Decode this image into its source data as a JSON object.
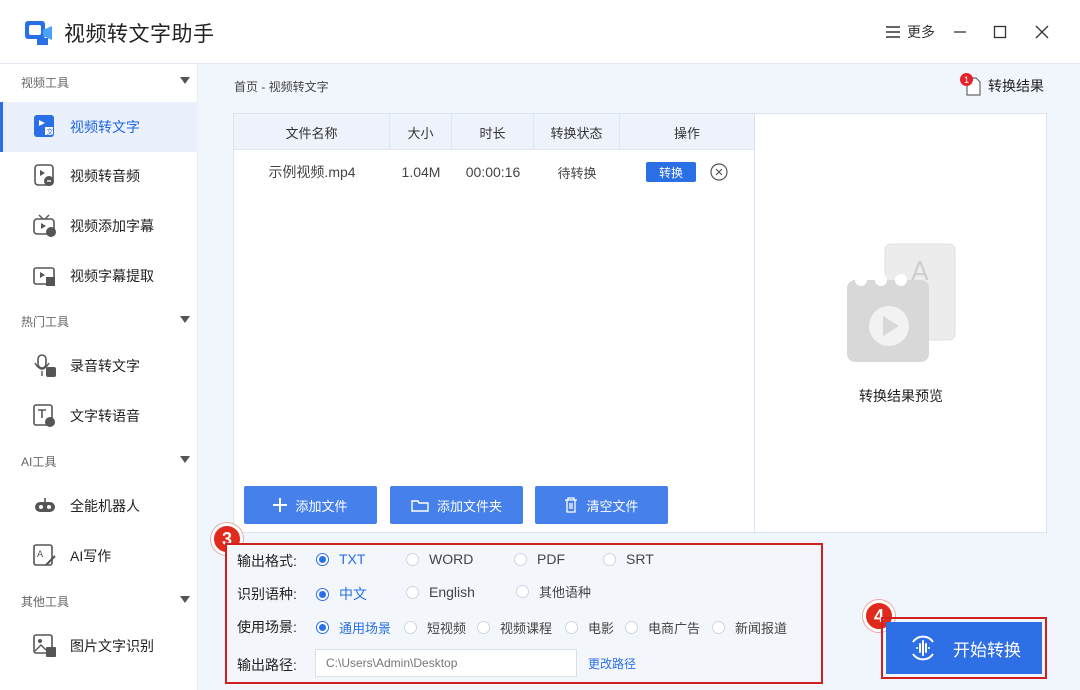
{
  "app": {
    "title": "视频转文字助手",
    "more_label": "更多"
  },
  "sidebar": {
    "groups": [
      {
        "label": "视频工具",
        "items": [
          {
            "label": "视频转文字",
            "icon": "video-to-text-icon",
            "active": true
          },
          {
            "label": "视频转音频",
            "icon": "video-to-audio-icon"
          },
          {
            "label": "视频添加字幕",
            "icon": "video-subtitle-icon"
          },
          {
            "label": "视频字幕提取",
            "icon": "subtitle-extract-icon"
          }
        ]
      },
      {
        "label": "热门工具",
        "items": [
          {
            "label": "录音转文字",
            "icon": "microphone-icon"
          },
          {
            "label": "文字转语音",
            "icon": "text-to-speech-icon"
          }
        ]
      },
      {
        "label": "AI工具",
        "items": [
          {
            "label": "全能机器人",
            "icon": "robot-icon"
          },
          {
            "label": "AI写作",
            "icon": "ai-writing-icon"
          }
        ]
      },
      {
        "label": "其他工具",
        "items": [
          {
            "label": "图片文字识别",
            "icon": "image-ocr-icon"
          }
        ]
      }
    ]
  },
  "breadcrumb": "首页 - 视频转文字",
  "result": {
    "label": "转换结果",
    "badge": "1"
  },
  "table": {
    "headers": [
      "文件名称",
      "大小",
      "时长",
      "转换状态",
      "操作"
    ],
    "rows": [
      {
        "name": "示例视频.mp4",
        "size": "1.04M",
        "duration": "00:00:16",
        "status": "待转换",
        "action": "转换"
      }
    ]
  },
  "buttons": {
    "add_file": "添加文件",
    "add_folder": "添加文件夹",
    "clear": "清空文件",
    "start": "开始转换",
    "change_path": "更改路径"
  },
  "preview": {
    "label": "转换结果预览"
  },
  "settings": {
    "format_label": "输出格式:",
    "formats": [
      "TXT",
      "WORD",
      "PDF",
      "SRT"
    ],
    "format_selected": "TXT",
    "lang_label": "识别语种:",
    "languages": [
      "中文",
      "English",
      "其他语种"
    ],
    "lang_selected": "中文",
    "scene_label": "使用场景:",
    "scenes": [
      "通用场景",
      "短视频",
      "视频课程",
      "电影",
      "电商广告",
      "新闻报道"
    ],
    "scene_selected": "通用场景",
    "path_label": "输出路径:",
    "path_placeholder": "C:\\Users\\Admin\\Desktop"
  },
  "steps": [
    "3",
    "4"
  ],
  "colors": {
    "accent": "#2b6fe6",
    "highlight": "#d02020",
    "badge": "#e5232b"
  }
}
